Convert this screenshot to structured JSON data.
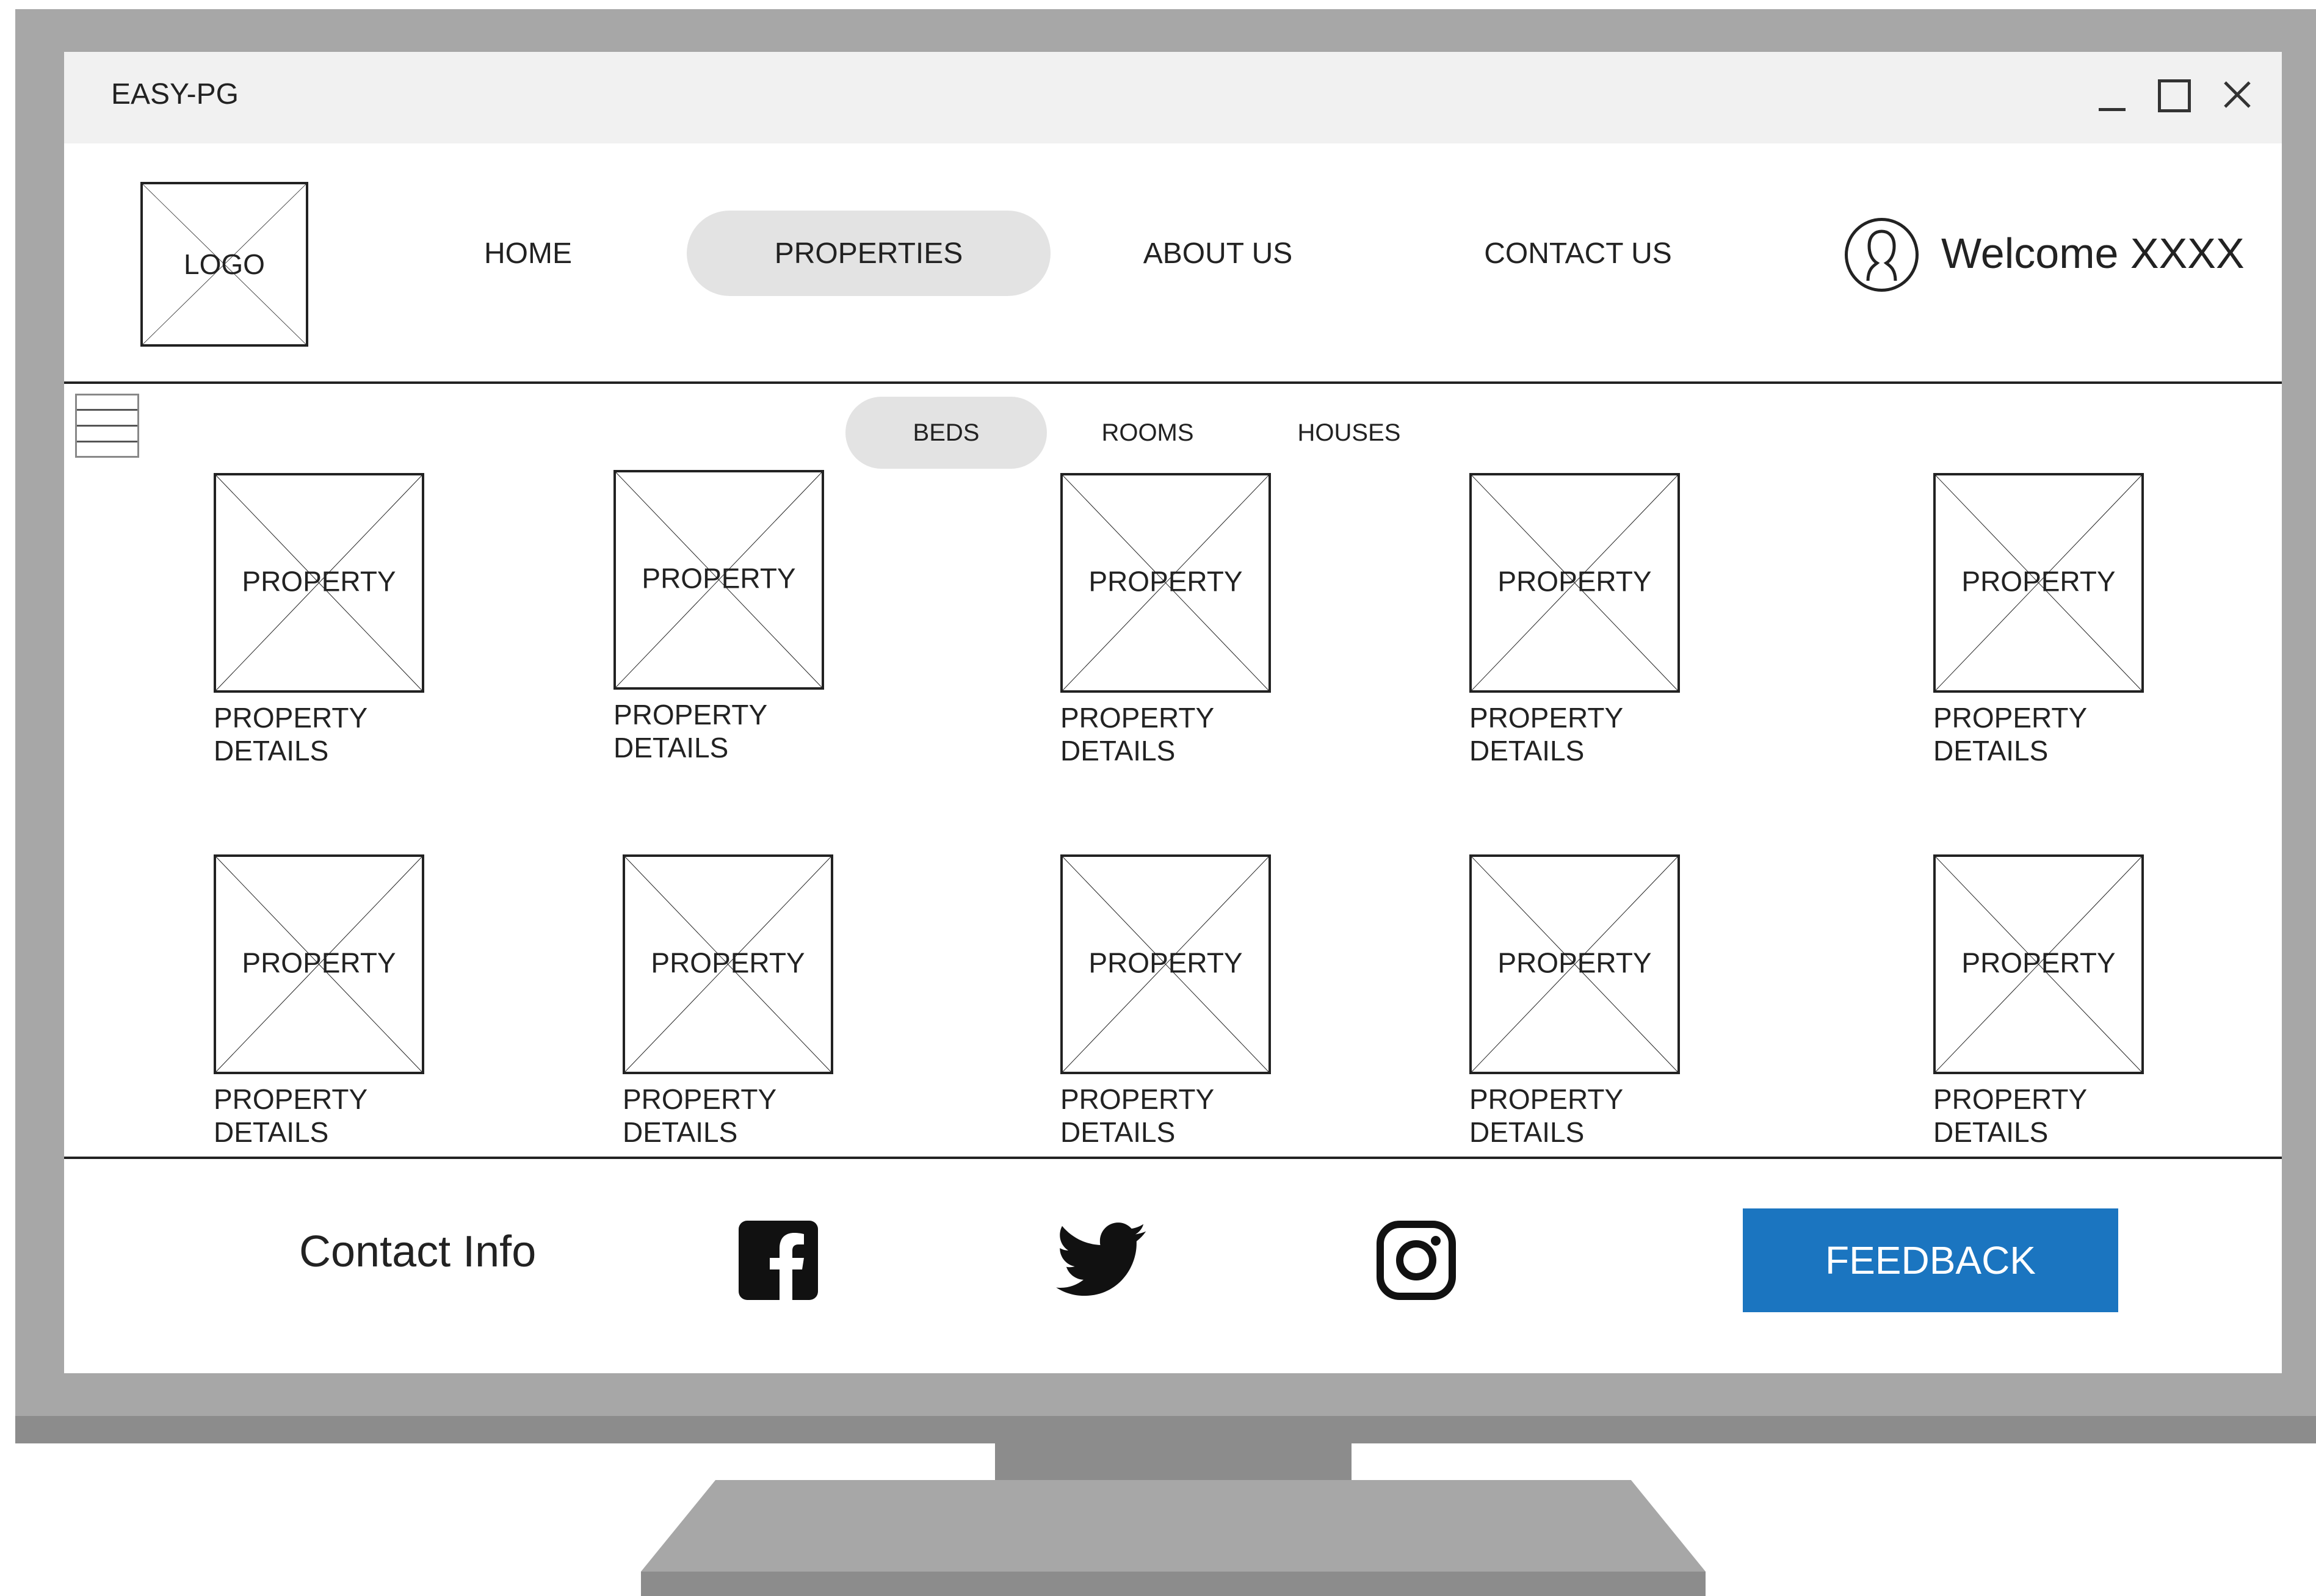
{
  "window": {
    "title": "EASY-PG",
    "controls": [
      "minimize-icon",
      "maximize-icon",
      "close-icon"
    ]
  },
  "header": {
    "logo_text": "LOGO",
    "nav": [
      {
        "label": "HOME",
        "active": false
      },
      {
        "label": "PROPERTIES",
        "active": true
      },
      {
        "label": "ABOUT US",
        "active": false
      },
      {
        "label": "CONTACT US",
        "active": false
      }
    ],
    "user_icon": "user-avatar-icon",
    "welcome": "Welcome XXXX"
  },
  "categories": {
    "tabs": [
      {
        "label": "BEDS",
        "active": true
      },
      {
        "label": "ROOMS",
        "active": false
      },
      {
        "label": "HOUSES",
        "active": false
      }
    ],
    "menu_icon": "hamburger-menu-icon"
  },
  "properties": [
    {
      "image_label": "PROPERTY",
      "details_line1": "PROPERTY",
      "details_line2": "DETAILS"
    },
    {
      "image_label": "PROPERTY",
      "details_line1": "PROPERTY",
      "details_line2": "DETAILS"
    },
    {
      "image_label": "PROPERTY",
      "details_line1": "PROPERTY",
      "details_line2": "DETAILS"
    },
    {
      "image_label": "PROPERTY",
      "details_line1": "PROPERTY",
      "details_line2": "DETAILS"
    },
    {
      "image_label": "PROPERTY",
      "details_line1": "PROPERTY",
      "details_line2": "DETAILS"
    },
    {
      "image_label": "PROPERTY",
      "details_line1": "PROPERTY",
      "details_line2": "DETAILS"
    },
    {
      "image_label": "PROPERTY",
      "details_line1": "PROPERTY",
      "details_line2": "DETAILS"
    },
    {
      "image_label": "PROPERTY",
      "details_line1": "PROPERTY",
      "details_line2": "DETAILS"
    },
    {
      "image_label": "PROPERTY",
      "details_line1": "PROPERTY",
      "details_line2": "DETAILS"
    },
    {
      "image_label": "PROPERTY",
      "details_line1": "PROPERTY",
      "details_line2": "DETAILS"
    }
  ],
  "footer": {
    "contact_info": "Contact Info",
    "social_icons": [
      "facebook-icon",
      "twitter-icon",
      "instagram-icon"
    ],
    "feedback_label": "FEEDBACK"
  },
  "colors": {
    "accent": "#1b75c0",
    "active_pill": "#e3e3e3",
    "bezel": "#a7a7a7"
  }
}
